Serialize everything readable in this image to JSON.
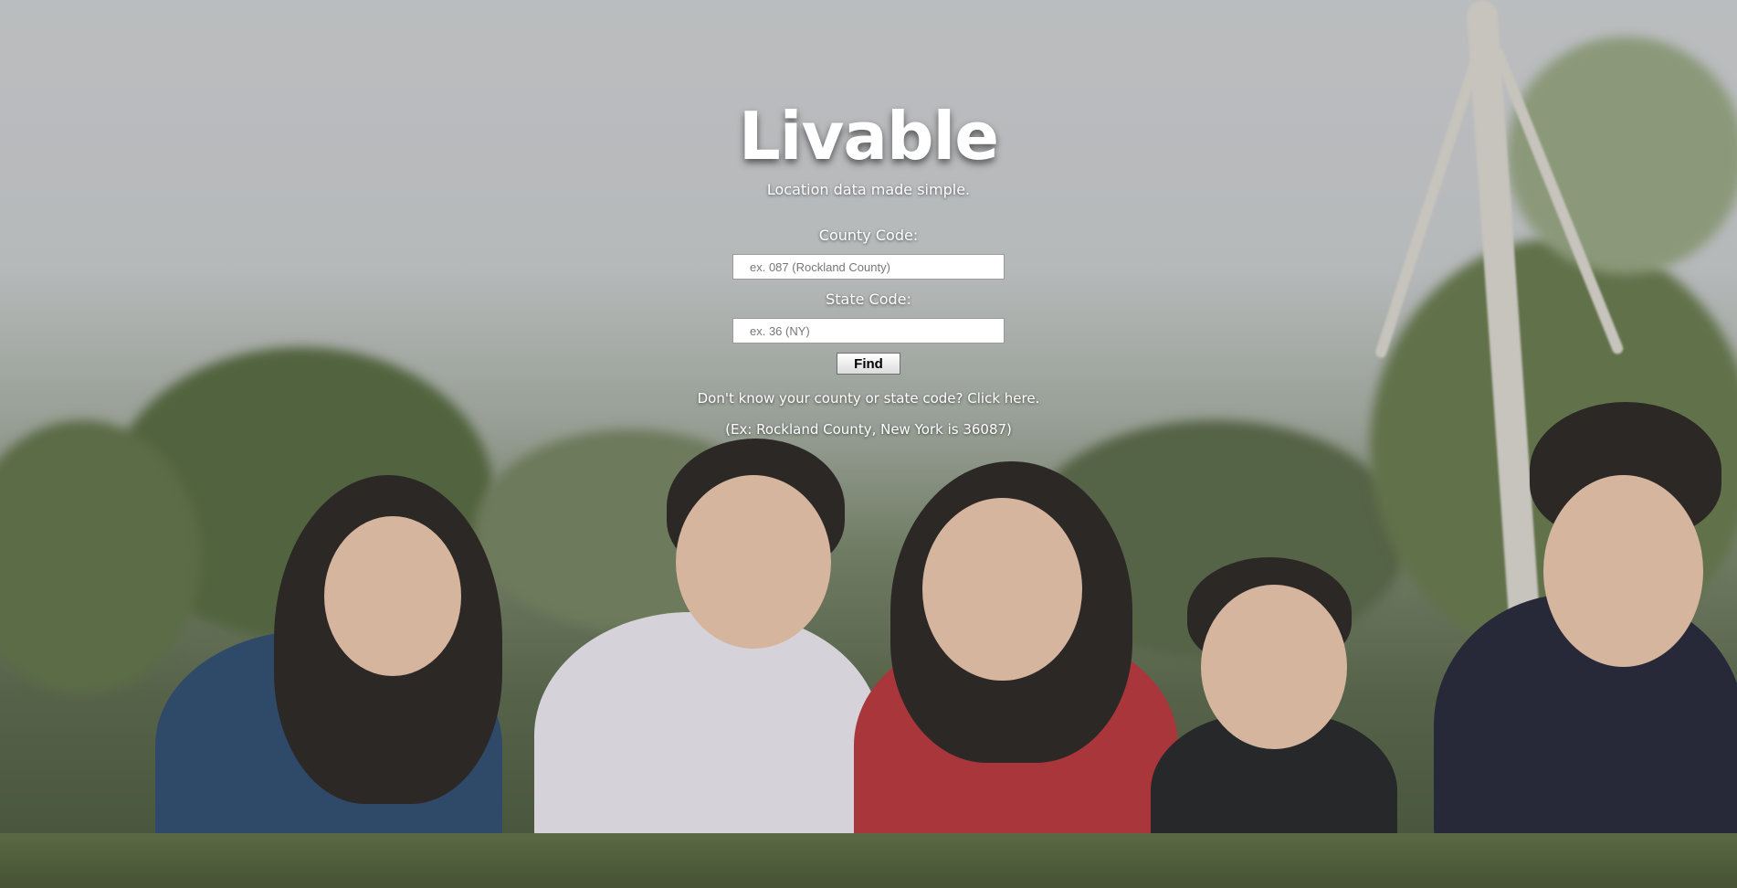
{
  "brand": {
    "title": "Livable",
    "tagline": "Location data made simple."
  },
  "form": {
    "county": {
      "label": "County Code:",
      "value": "",
      "placeholder": "ex. 087 (Rockland County)"
    },
    "state": {
      "label": "State Code:",
      "value": "",
      "placeholder": "ex. 36 (NY)"
    },
    "submit_label": "Find"
  },
  "help": {
    "question": "Don't know your county or state code?",
    "link_label": "Click here.",
    "example": "(Ex: Rockland County, New York is 36087)"
  }
}
